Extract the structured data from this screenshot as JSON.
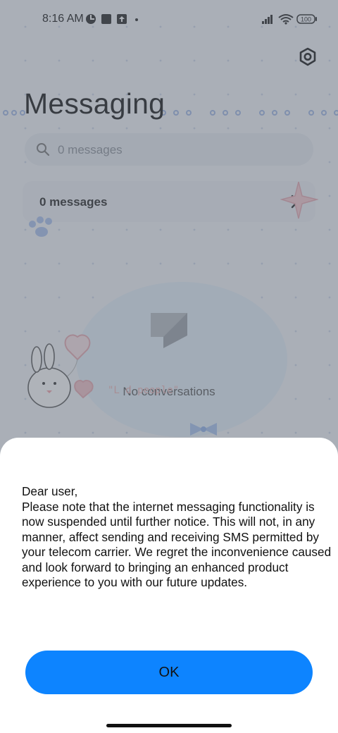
{
  "status_bar": {
    "time": "8:16 AM",
    "battery": "100"
  },
  "header": {
    "title": "Messaging"
  },
  "search": {
    "placeholder": "0 messages"
  },
  "message_card": {
    "label": "0 messages"
  },
  "empty_state": {
    "text": "No conversations",
    "decor_text": "\"L           d people\""
  },
  "dialog": {
    "message": "Dear user,\nPlease note that the internet messaging functionality is now suspended until further notice. This will not, in any manner, affect sending and receiving SMS permitted by your telecom carrier. We regret the inconvenience caused and look forward to bringing an enhanced product experience to you with our future updates.",
    "ok_label": "OK"
  },
  "colors": {
    "accent": "#0d84ff",
    "scrim": "#606874"
  }
}
